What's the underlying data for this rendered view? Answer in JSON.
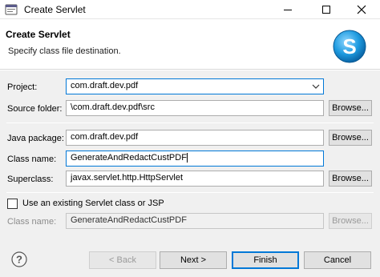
{
  "window": {
    "title": "Create Servlet",
    "icon": "eclipse-window-icon"
  },
  "header": {
    "title": "Create Servlet",
    "subtitle": "Specify class file destination.",
    "logo_letter": "S"
  },
  "form": {
    "project_label": "Project:",
    "project_value": "com.draft.dev.pdf",
    "source_folder_label": "Source folder:",
    "source_folder_value": "\\com.draft.dev.pdf\\src",
    "java_package_label": "Java package:",
    "java_package_value": "com.draft.dev.pdf",
    "class_name_label": "Class name:",
    "class_name_value": "GenerateAndRedactCustPDF",
    "superclass_label": "Superclass:",
    "superclass_value": "javax.servlet.http.HttpServlet",
    "use_existing_label": "Use an existing Servlet class or JSP",
    "existing_class_label": "Class name:",
    "existing_class_value": "GenerateAndRedactCustPDF",
    "browse_label": "Browse..."
  },
  "footer": {
    "back_label": "< Back",
    "next_label": "Next >",
    "finish_label": "Finish",
    "cancel_label": "Cancel"
  },
  "colors": {
    "focus_border": "#0078d7",
    "dialog_bg": "#f0f0f0"
  }
}
